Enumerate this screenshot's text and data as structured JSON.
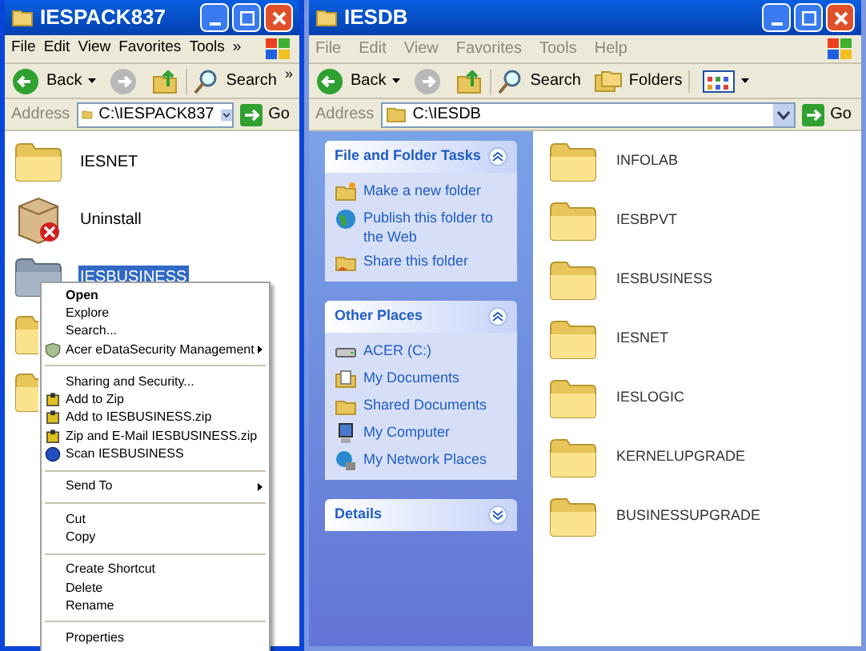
{
  "left_window": {
    "title": "IESPACK837",
    "menu": [
      "File",
      "Edit",
      "View",
      "Favorites",
      "Tools",
      "»"
    ],
    "toolbar": {
      "back": "Back",
      "search": "Search",
      "more": "»"
    },
    "address": {
      "label": "Address",
      "value": "C:\\IESPACK837",
      "go": "Go"
    },
    "items": [
      {
        "kind": "folder",
        "label": "IESNET",
        "selected": false
      },
      {
        "kind": "setup",
        "label": "Uninstall",
        "selected": false
      },
      {
        "kind": "folder",
        "label": "IESBUSINESS",
        "selected": true
      },
      {
        "kind": "folder"
      },
      {
        "kind": "folder"
      }
    ]
  },
  "context_menu": [
    {
      "kind": "item",
      "label": "Open",
      "default": true
    },
    {
      "kind": "item",
      "label": "Explore"
    },
    {
      "kind": "item",
      "label": "Search..."
    },
    {
      "kind": "shield",
      "label": "Acer eDataSecurity Management",
      "submenu": true
    },
    {
      "kind": "separator"
    },
    {
      "kind": "item",
      "label": "Sharing and Security..."
    },
    {
      "kind": "zip",
      "label": "Add to Zip"
    },
    {
      "kind": "zip",
      "label": "Add to IESBUSINESS.zip"
    },
    {
      "kind": "zip",
      "label": "Zip and E-Mail IESBUSINESS.zip"
    },
    {
      "kind": "scan",
      "label": "Scan IESBUSINESS"
    },
    {
      "kind": "separator"
    },
    {
      "kind": "item",
      "label": "Send To",
      "submenu": true
    },
    {
      "kind": "separator"
    },
    {
      "kind": "item",
      "label": "Cut"
    },
    {
      "kind": "item",
      "label": "Copy"
    },
    {
      "kind": "separator"
    },
    {
      "kind": "item",
      "label": "Create Shortcut"
    },
    {
      "kind": "item",
      "label": "Delete"
    },
    {
      "kind": "item",
      "label": "Rename"
    },
    {
      "kind": "separator"
    },
    {
      "kind": "item",
      "label": "Properties"
    }
  ],
  "right_window": {
    "title": "IESDB",
    "menu": [
      "File",
      "Edit",
      "View",
      "Favorites",
      "Tools",
      "Help"
    ],
    "toolbar": {
      "back": "Back",
      "search": "Search",
      "folders": "Folders"
    },
    "address": {
      "label": "Address",
      "value": "C:\\IESDB",
      "go": "Go"
    },
    "task_pane": [
      {
        "title": "File and Folder Tasks",
        "expanded": true,
        "items": [
          {
            "kind": "new-folder",
            "label": "Make a new folder"
          },
          {
            "kind": "globe",
            "label": "Publish this folder to the Web"
          },
          {
            "kind": "share",
            "label": "Share this folder"
          }
        ]
      },
      {
        "title": "Other Places",
        "expanded": true,
        "items": [
          {
            "kind": "drive",
            "label": "ACER (C:)"
          },
          {
            "kind": "docs",
            "label": "My Documents"
          },
          {
            "kind": "folder",
            "label": "Shared Documents"
          },
          {
            "kind": "computer",
            "label": "My Computer"
          },
          {
            "kind": "network",
            "label": "My Network Places"
          }
        ]
      },
      {
        "title": "Details",
        "expanded": false
      }
    ],
    "folders": [
      "INFOLAB",
      "IESBPVT",
      "IESBUSINESS",
      "IESNET",
      "IESLOGIC",
      "KERNELUPGRADE",
      "BUSINESSUPGRADE"
    ]
  }
}
